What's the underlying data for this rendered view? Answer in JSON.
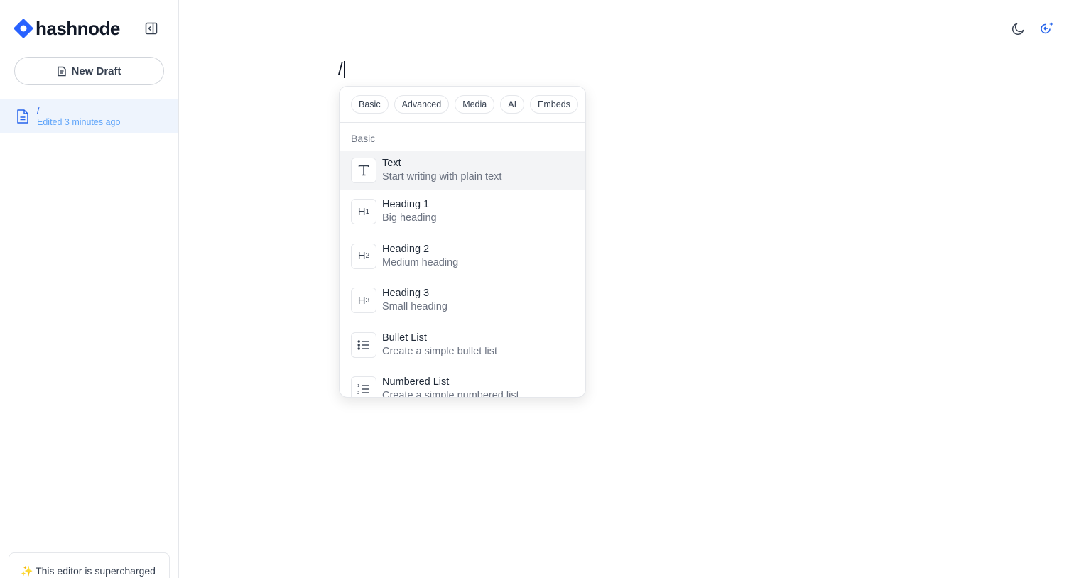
{
  "brand": {
    "name": "hashnode",
    "accent": "#2962ff"
  },
  "sidebar": {
    "new_draft_label": "New Draft",
    "drafts": [
      {
        "title": "/",
        "meta": "Edited 3 minutes ago"
      }
    ],
    "promo": "✨ This editor is supercharged"
  },
  "editor": {
    "content": "/"
  },
  "slash_menu": {
    "tabs": [
      "Basic",
      "Advanced",
      "Media",
      "AI",
      "Embeds"
    ],
    "section": "Basic",
    "items": [
      {
        "label": "Text",
        "desc": "Start writing with plain text",
        "icon": "text-icon"
      },
      {
        "label": "Heading 1",
        "desc": "Big heading",
        "icon": "heading-1-icon"
      },
      {
        "label": "Heading 2",
        "desc": "Medium heading",
        "icon": "heading-2-icon"
      },
      {
        "label": "Heading 3",
        "desc": "Small heading",
        "icon": "heading-3-icon"
      },
      {
        "label": "Bullet List",
        "desc": "Create a simple bullet list",
        "icon": "bullet-list-icon"
      },
      {
        "label": "Numbered List",
        "desc": "Create a simple numbered list",
        "icon": "numbered-list-icon"
      }
    ]
  },
  "icons": {
    "collapse": "sidebar-collapse-icon",
    "theme": "moon-icon",
    "ai": "ai-sparkle-icon"
  }
}
